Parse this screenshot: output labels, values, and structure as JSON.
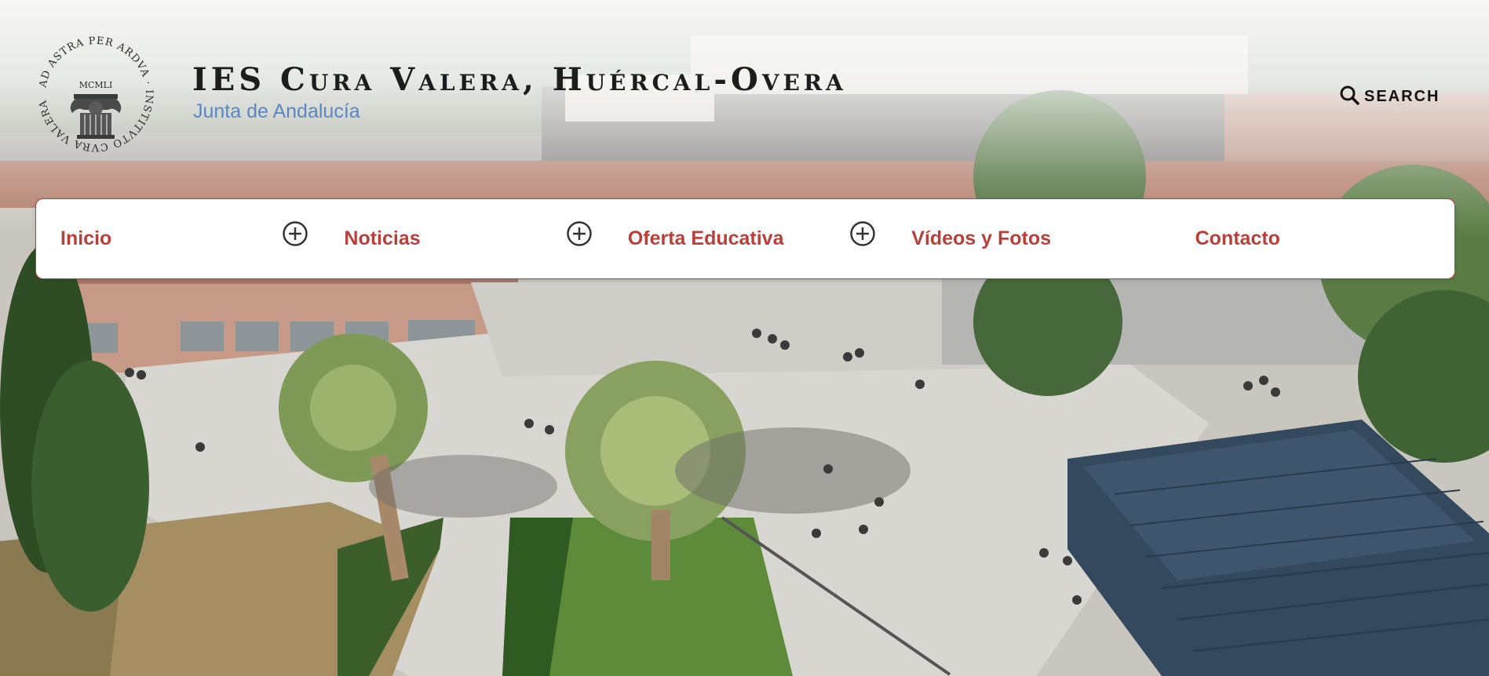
{
  "header": {
    "site_title": "IES Cura Valera, Huércal-Overa",
    "site_subtitle": "Junta de Andalucía",
    "logo": {
      "ring_text": "AD ASTRA PER ARDVA · INSTITVTO CVRA VALERA ·",
      "year_text": "MCMLI",
      "icon": "school-crest-icon"
    },
    "search": {
      "label": "SEARCH",
      "icon": "search-icon"
    }
  },
  "nav": {
    "items": [
      {
        "label": "Inicio",
        "has_submenu": true
      },
      {
        "label": "Noticias",
        "has_submenu": true
      },
      {
        "label": "Oferta Educativa",
        "has_submenu": true
      },
      {
        "label": "Vídeos y Fotos",
        "has_submenu": false
      },
      {
        "label": "Contacto",
        "has_submenu": false
      }
    ],
    "toggle_icon": "plus-circle-icon"
  },
  "colors": {
    "accent": "#b8403a",
    "subtitle": "#5b86c4",
    "title": "#1d1d1d"
  }
}
